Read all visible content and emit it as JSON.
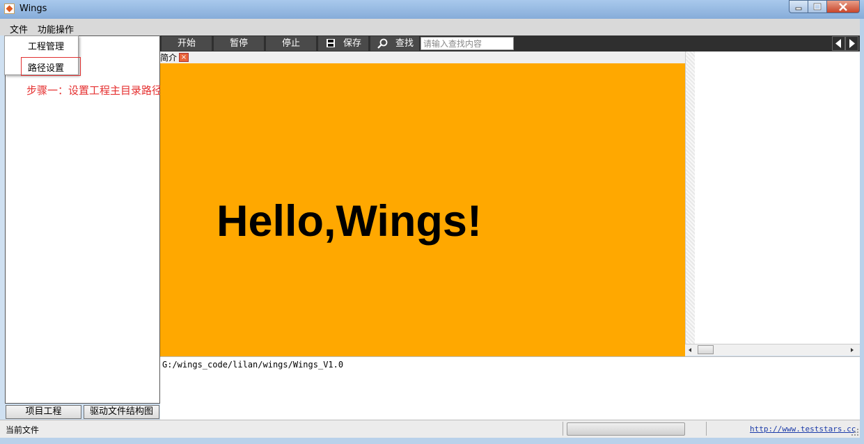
{
  "window": {
    "title": "Wings"
  },
  "menubar": {
    "file": "文件",
    "functions": "功能操作"
  },
  "dropdown": {
    "items": [
      "工程管理",
      "路径设置"
    ]
  },
  "annotation": "步骤一：设置工程主目录路径",
  "left_panel": {
    "buttons": [
      "项目工程",
      "驱动文件结构图"
    ]
  },
  "toolbar": {
    "start": "开始",
    "pause": "暂停",
    "stop": "停止",
    "save": "保存",
    "find": "查找",
    "search_placeholder": "请输入查找内容"
  },
  "editor": {
    "tab_label": "简介",
    "tab_close": "×",
    "content_text": "Hello,Wings!",
    "content_bg": "#ffa800"
  },
  "console": {
    "path": "G:/wings_code/lilan/wings/Wings_V1.0"
  },
  "statusbar": {
    "label": "当前文件",
    "link": "http://www.teststars.cc"
  }
}
